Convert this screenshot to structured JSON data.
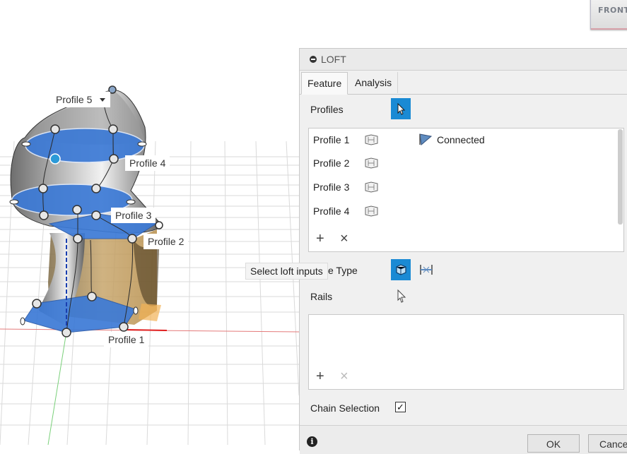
{
  "viewcube": {
    "face_label": "FRONT"
  },
  "viewport": {
    "labels": {
      "profile5": "Profile 5",
      "profile4": "Profile 4",
      "profile3": "Profile 3",
      "profile2": "Profile 2",
      "profile1": "Profile 1"
    },
    "profile5_dropdown_icon": "dropdown-triangle-icon",
    "tooltip": "Select loft inputs"
  },
  "panel": {
    "title": "LOFT",
    "tabs": [
      "Feature",
      "Analysis"
    ],
    "profiles_label": "Profiles",
    "profiles": [
      {
        "name": "Profile 1",
        "status": "Connected"
      },
      {
        "name": "Profile 2"
      },
      {
        "name": "Profile 3"
      },
      {
        "name": "Profile 4"
      }
    ],
    "add_symbol": "+",
    "remove_symbol": "×",
    "type_label_partial": "e Type",
    "rails_label": "Rails",
    "chain_selection_label": "Chain Selection",
    "chain_selection_checked": "✓",
    "info_symbol": "i",
    "ok_label": "OK",
    "cancel_label": "Cance",
    "accent_color": "#1a8ad4"
  }
}
